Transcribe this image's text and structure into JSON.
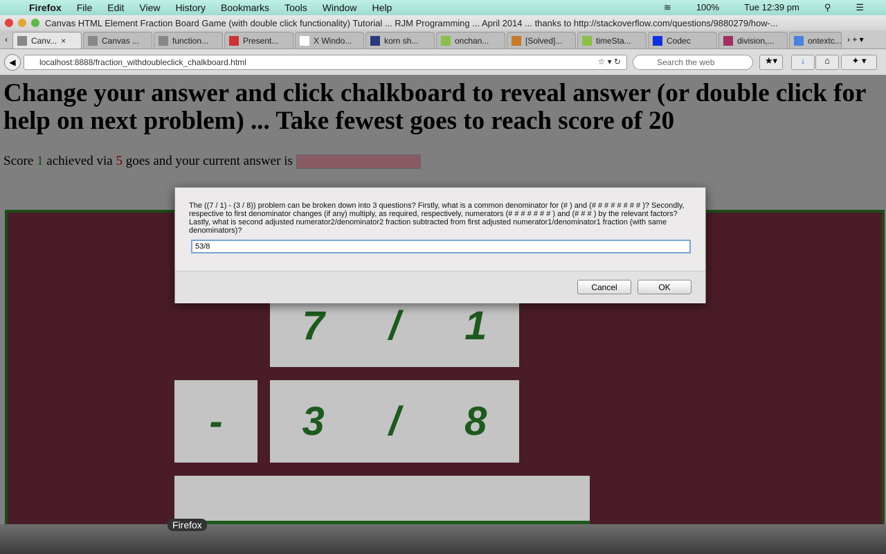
{
  "menubar": {
    "app": "Firefox",
    "items": [
      "File",
      "Edit",
      "View",
      "History",
      "Bookmarks",
      "Tools",
      "Window",
      "Help"
    ],
    "battery": "100%",
    "clock": "Tue 12:39 pm"
  },
  "window_title": "Canvas HTML Element Fraction Board Game (with double click functionality) Tutorial ... RJM Programming ... April 2014 ... thanks to http://stackoverflow.com/questions/9880279/how-...",
  "tabs": [
    "Canv...",
    "Canvas ...",
    "function...",
    "Present...",
    "X Windo...",
    "korn sh...",
    "onchan...",
    "[Solved]...",
    "timeSta...",
    "Codec",
    "division,...",
    "ontextc..."
  ],
  "url": "localhost:8888/fraction_withdoubleclick_chalkboard.html",
  "search_placeholder": "Search the web",
  "page": {
    "heading": "Change your answer and click chalkboard to reveal answer (or double click for help on next problem) ... Take fewest goes to reach score of 20",
    "score_prefix": "Score",
    "score": "1",
    "via": "achieved via",
    "goes": "5",
    "suffix": "goes and your current answer is"
  },
  "board": {
    "num1": "7",
    "den1": "1",
    "op": "-",
    "num2": "3",
    "den2": "8",
    "slash": "/"
  },
  "dialog": {
    "message": "The ((7 / 1) - (3 / 8)) problem can be broken down into 3 questions?  Firstly, what is a common denominator for (# ) and (# # # # # # # # )?  Secondly, respective to first denominator changes (if any) multiply, as required, respectively, numerators (# # # # # # # ) and (# # # ) by the relevant factors?  Lastly, what is second adjusted numerator2/denominator2 fraction subtracted from first adjusted numerator1/denominator1 fraction (with same denominators)?",
    "input_value": "53/8",
    "cancel": "Cancel",
    "ok": "OK"
  },
  "dock": {
    "label": "Firefox"
  }
}
